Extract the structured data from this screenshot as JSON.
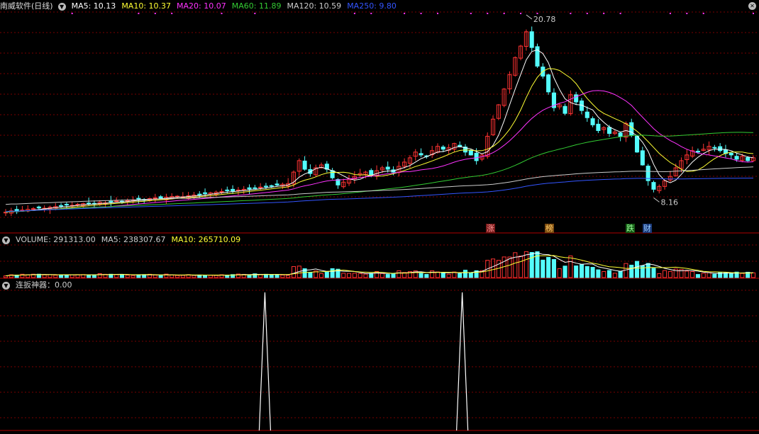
{
  "main_header": {
    "title": "南威软件(日线)",
    "ma": [
      {
        "label": "MA5: 10.13",
        "color": "#ffffff"
      },
      {
        "label": "MA10: 10.37",
        "color": "#ffff33"
      },
      {
        "label": "MA20: 10.07",
        "color": "#ff33ff"
      },
      {
        "label": "MA60: 11.89",
        "color": "#33cc33"
      },
      {
        "label": "MA120: 10.59",
        "color": "#cccccc"
      },
      {
        "label": "MA250: 9.80",
        "color": "#3355ff"
      }
    ]
  },
  "volume_header": {
    "items": [
      {
        "label": "VOLUME: 291313.00",
        "color": "#cccccc"
      },
      {
        "label": "MA5: 238307.67",
        "color": "#cccccc"
      },
      {
        "label": "MA10: 265710.09",
        "color": "#ffff33"
      }
    ]
  },
  "indicator_header": {
    "label": "连扳神器：0.00",
    "color": "#cccccc"
  },
  "annotations": {
    "high": "20.78",
    "low": "8.16"
  },
  "event_tags": [
    {
      "text": "涨",
      "bg": "#7a1a1a",
      "color": "#ff9999"
    },
    {
      "text": "榜",
      "bg": "#7a4a10",
      "color": "#ffcc66"
    },
    {
      "text": "跌",
      "bg": "#145a14",
      "color": "#99ff99"
    },
    {
      "text": "财",
      "bg": "#1a3a7a",
      "color": "#99ccff"
    }
  ],
  "colors": {
    "up": "#ff3333",
    "down": "#54fcfc",
    "grid": "#7a0000",
    "axis": "#b00000"
  },
  "chart_data": {
    "type": "candlestick",
    "price_close": [
      7.0,
      7.1,
      7.05,
      7.15,
      7.2,
      7.25,
      7.3,
      7.28,
      7.35,
      7.4,
      7.45,
      7.5,
      7.48,
      7.55,
      7.6,
      7.62,
      7.58,
      7.7,
      7.65,
      7.72,
      7.8,
      7.75,
      7.82,
      7.85,
      7.9,
      7.88,
      7.95,
      8.0,
      7.98,
      8.05,
      8.1,
      8.12,
      8.08,
      8.15,
      8.2,
      8.25,
      8.3,
      8.35,
      8.4,
      8.45,
      8.5,
      8.48,
      8.55,
      8.6,
      8.62,
      8.7,
      8.75,
      8.8,
      8.85,
      8.9,
      8.95,
      9.0,
      9.8,
      10.6,
      10.0,
      9.7,
      10.1,
      10.3,
      10.0,
      9.4,
      8.9,
      9.1,
      9.3,
      9.5,
      9.7,
      9.8,
      9.6,
      9.9,
      10.1,
      10.0,
      9.8,
      10.2,
      10.5,
      10.8,
      11.2,
      11.0,
      10.9,
      11.3,
      11.6,
      11.4,
      11.5,
      11.8,
      11.6,
      11.2,
      11.0,
      10.6,
      11.0,
      12.3,
      13.5,
      14.5,
      15.6,
      16.6,
      17.8,
      18.6,
      19.6,
      18.5,
      17.2,
      16.5,
      15.4,
      14.3,
      14.5,
      13.9,
      15.2,
      14.7,
      14.1,
      13.6,
      13.1,
      12.7,
      12.9,
      12.5,
      12.6,
      12.3,
      13.2,
      12.4,
      11.2,
      10.3,
      9.2,
      8.6,
      8.8,
      9.2,
      9.5,
      10.1,
      10.6,
      11.0,
      11.3,
      11.2,
      11.4,
      11.6,
      11.5,
      11.3,
      11.1,
      11.0,
      10.7,
      10.9,
      10.6,
      10.8
    ],
    "price_high": 20.78,
    "price_low": 8.16,
    "volume_ma5": 238307.67,
    "volume_ma10": 265710.09,
    "indicator_spikes_at": [
      0.349,
      0.609
    ]
  }
}
